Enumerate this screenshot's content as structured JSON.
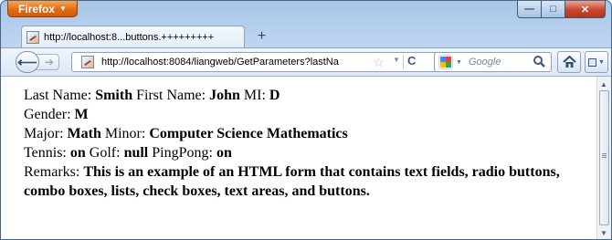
{
  "browser": {
    "menu_button_label": "Firefox",
    "tab": {
      "title": "http://localhost:8...buttons.+++++++++"
    },
    "new_tab_symbol": "+",
    "address": "http://localhost:8084/liangweb/GetParameters?lastNa",
    "search_placeholder": "Google",
    "caption": {
      "minimize": "—",
      "maximize": "□",
      "close": "✕"
    }
  },
  "page": {
    "line1": {
      "last_name_label": "Last Name:",
      "last_name_value": "Smith",
      "first_name_label": "First Name:",
      "first_name_value": "John",
      "mi_label": "MI:",
      "mi_value": "D"
    },
    "line2": {
      "gender_label": "Gender:",
      "gender_value": "M"
    },
    "line3": {
      "major_label": "Major:",
      "major_value": "Math",
      "minor_label": "Minor:",
      "minor_value": "Computer Science Mathematics"
    },
    "line4": {
      "tennis_label": "Tennis:",
      "tennis_value": "on",
      "golf_label": "Golf:",
      "golf_value": "null",
      "pingpong_label": "PingPong:",
      "pingpong_value": "on"
    },
    "line5": {
      "remarks_label": "Remarks:",
      "remarks_value": "This is an example of an HTML form that contains text fields, radio buttons, combo boxes, lists, check boxes, text areas, and buttons."
    }
  }
}
